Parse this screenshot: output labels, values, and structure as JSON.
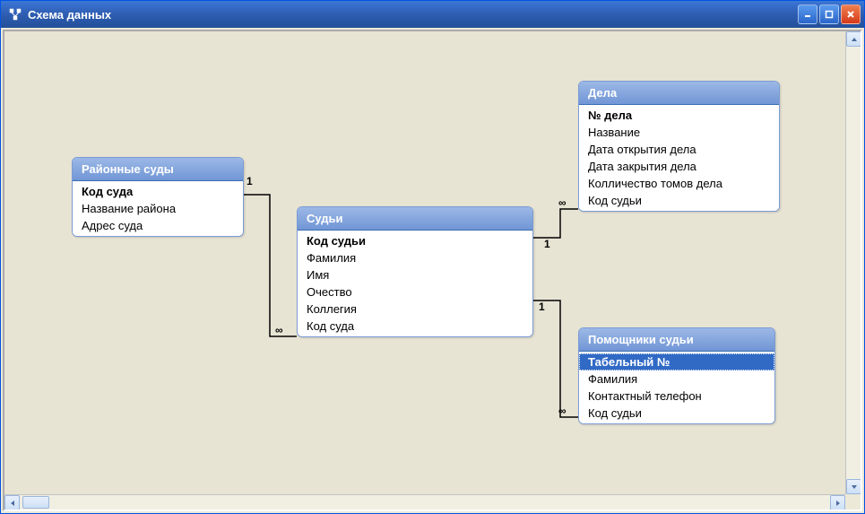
{
  "window": {
    "title": "Схема данных"
  },
  "tables": {
    "courts": {
      "title": "Районные суды",
      "fields": [
        "Код суда",
        "Название района",
        "Адрес суда"
      ],
      "pk_index": 0
    },
    "judges": {
      "title": "Судьи",
      "fields": [
        "Код судьи",
        "Фамилия",
        "Имя",
        "Очество",
        "Коллегия",
        "Код суда"
      ],
      "pk_index": 0
    },
    "cases": {
      "title": "Дела",
      "fields": [
        "№  дела",
        "Название",
        "Дата открытия дела",
        "Дата закрытия дела",
        "Колличество томов дела",
        "Код судьи"
      ],
      "pk_index": 0
    },
    "assistants": {
      "title": "Помощники судьи",
      "fields": [
        "Табельный №",
        "Фамилия",
        "Контактный телефон",
        "Код судьи"
      ],
      "pk_index": 0,
      "selected_index": 0
    }
  },
  "cardinality": {
    "one": "1",
    "many": "∞"
  }
}
